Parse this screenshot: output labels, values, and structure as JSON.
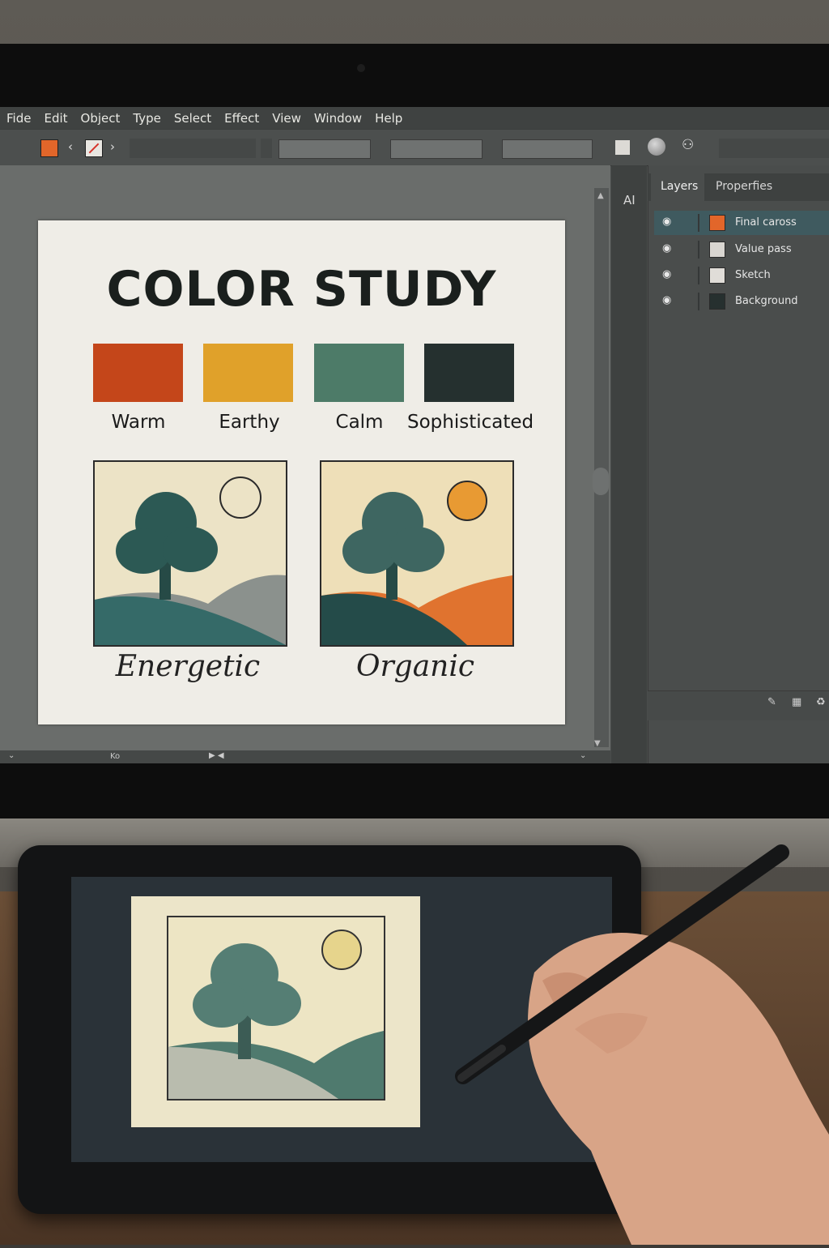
{
  "menu": [
    "Fide",
    "Edit",
    "Object",
    "Type",
    "Select",
    "Effect",
    "View",
    "Window",
    "Help"
  ],
  "toolbar": {
    "fill_color": "#e2662a",
    "stroke_icon": "no-stroke-icon",
    "nav_prev": "‹",
    "nav_next": "›"
  },
  "side_strip": {
    "label": "AI"
  },
  "panel": {
    "tabs": [
      "Layers",
      "Properfies"
    ],
    "layers": [
      {
        "name": "Final caross",
        "color": "#e2662a",
        "selected": true
      },
      {
        "name": "Value pass",
        "color": "#d9d6d1",
        "selected": false
      },
      {
        "name": "Sketch",
        "color": "#e0ddd8",
        "selected": false
      },
      {
        "name": "Background",
        "color": "#26302f",
        "selected": false
      }
    ]
  },
  "artboard": {
    "title": "COLOR STUDY",
    "swatches": [
      {
        "label": "Warm",
        "color": "#c4461a"
      },
      {
        "label": "Earthy",
        "color": "#e0a12a"
      },
      {
        "label": "Calm",
        "color": "#4d7b68"
      },
      {
        "label": "Sophisticated",
        "color": "#25302f"
      }
    ],
    "thumbnails": [
      {
        "label": "Energetic"
      },
      {
        "label": "Organic"
      }
    ]
  },
  "status": {
    "zoom": "Ko"
  }
}
